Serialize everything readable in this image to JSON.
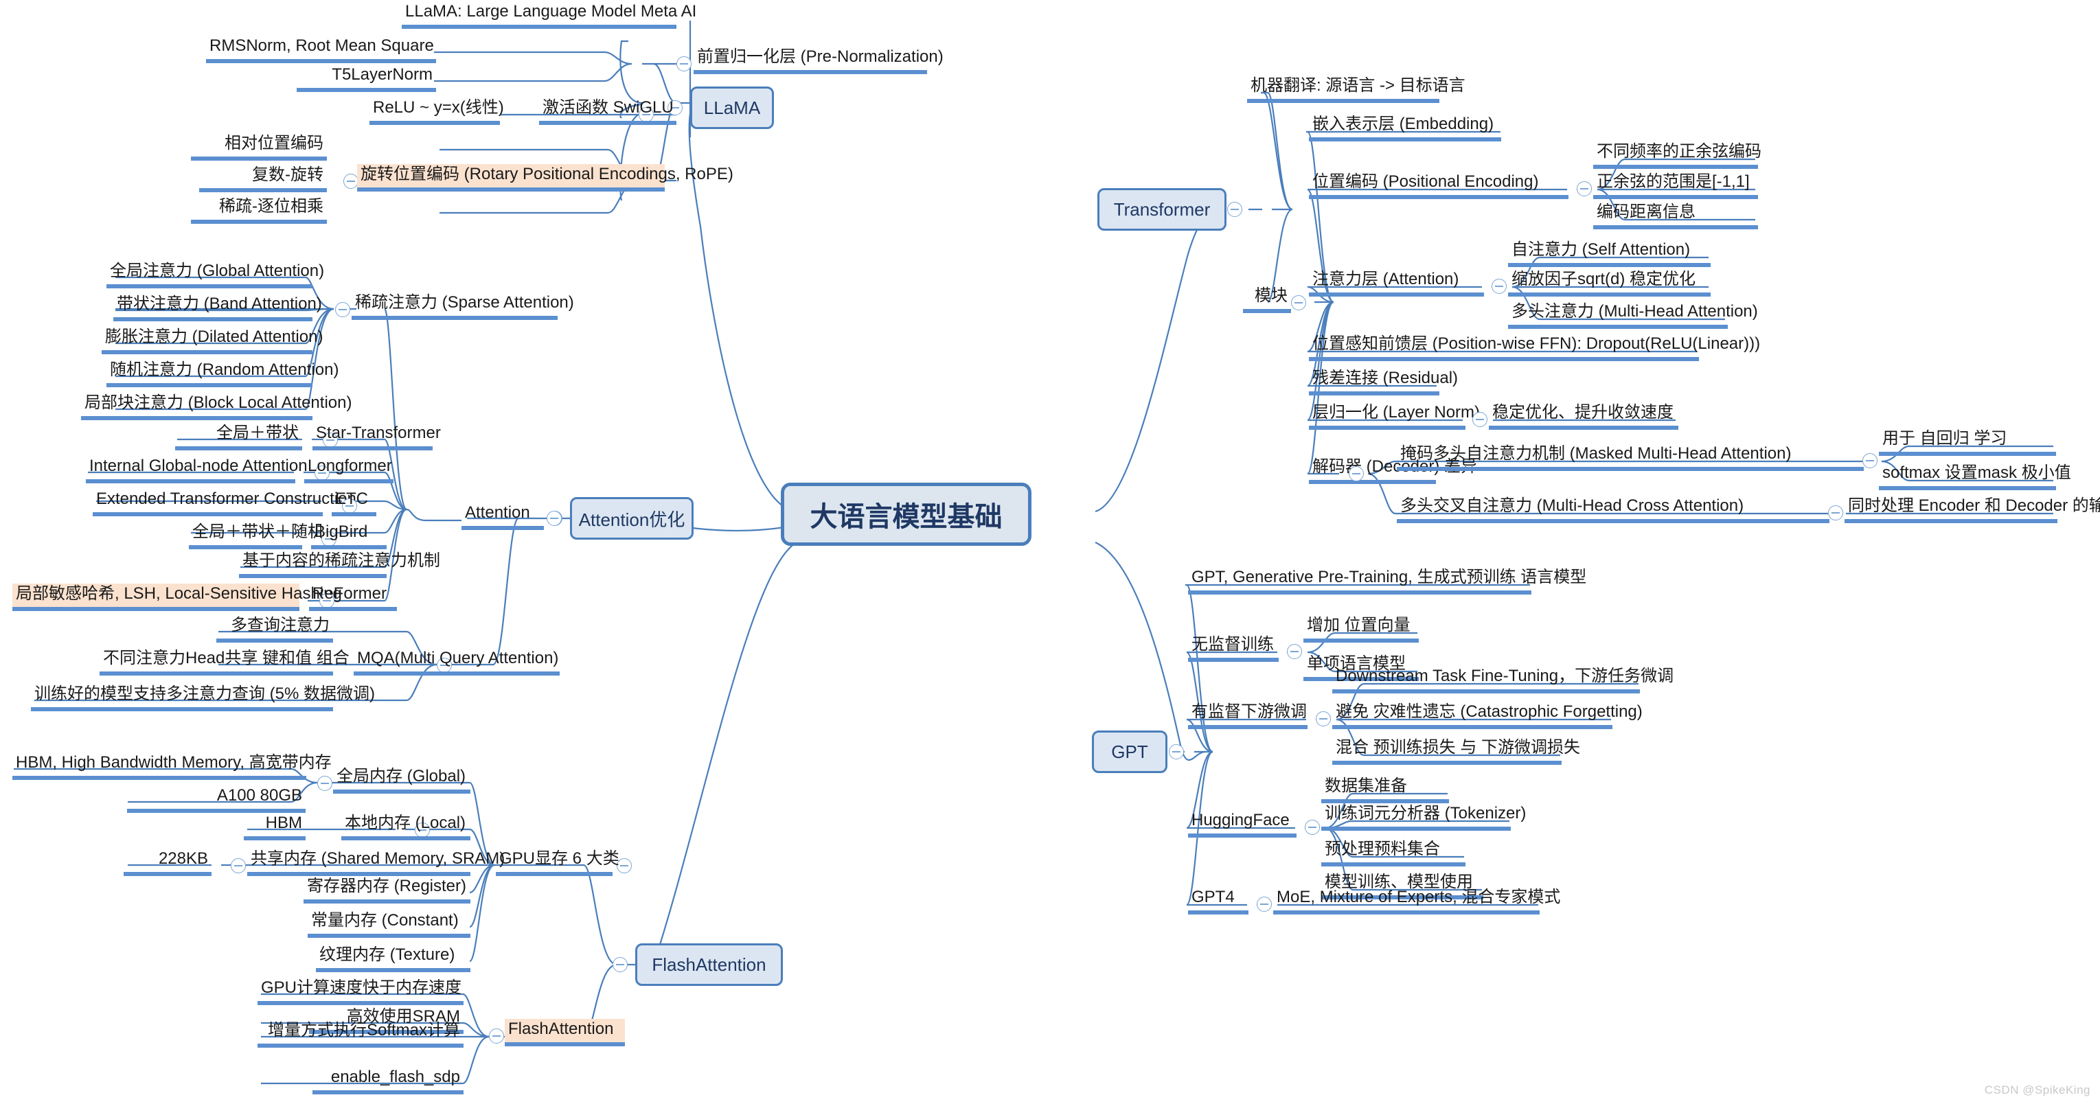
{
  "meta": {
    "watermark": "CSDN @SpikeKing",
    "colors": {
      "branch_line": "#4a7ebb",
      "leaf_bar": "#5b8fd0",
      "node_fill": "#dce6f2",
      "node_border": "#4a7ebb",
      "node_text": "#1f3864",
      "highlight_fill": "#fbe2cf",
      "background": "#ffffff"
    }
  },
  "root": {
    "label": "大语言模型基础"
  },
  "branches": {
    "llama": {
      "label": "LLaMA",
      "children": {
        "title": "LLaMA: Large Language Model Meta AI",
        "prenorm": {
          "label": "前置归一化层 (Pre-Normalization)",
          "items": [
            "RMSNorm, Root Mean Square",
            "T5LayerNorm"
          ]
        },
        "activation": {
          "label": "激活函数 SwiGLU",
          "items": [
            "ReLU ~ y=x(线性)"
          ]
        },
        "rope": {
          "label": "旋转位置编码 (Rotary Positional Encodings, RoPE)",
          "items": [
            "相对位置编码",
            "复数-旋转",
            "稀疏-逐位相乘"
          ]
        }
      }
    },
    "attention_opt": {
      "label": "Attention优化",
      "sub": {
        "label": "Attention",
        "sparse": {
          "label": "稀疏注意力 (Sparse Attention)",
          "items": [
            "全局注意力 (Global Attention)",
            "带状注意力 (Band Attention)",
            "膨胀注意力 (Dilated Attention)",
            "随机注意力 (Random Attention)",
            "局部块注意力 (Block Local Attention)"
          ]
        },
        "models": [
          {
            "name": "Star-Transformer",
            "desc": "全局＋带状"
          },
          {
            "name": "Longformer",
            "desc": "Internal Global-node Attention"
          },
          {
            "name": "ETC",
            "desc": "Extended Transformer Construction"
          },
          {
            "name": "BigBird",
            "desc": "全局＋带状＋随机"
          },
          {
            "name": "ReFormer",
            "desc": "局部敏感哈希, LSH, Local-Sensitive Hashing",
            "highlight": true
          }
        ],
        "content_sparse": "基于内容的稀疏注意力机制"
      },
      "mqa": {
        "label": "MQA(Multi Query Attention)",
        "items": [
          "多查询注意力",
          "不同注意力Head共享 键和值 组合",
          "训练好的模型支持多注意力查询 (5% 数据微调)"
        ]
      }
    },
    "flashattention": {
      "label": "FlashAttention",
      "gpu_memory": {
        "label": "GPU显存 6 大类",
        "items": [
          {
            "name": "全局内存 (Global)",
            "notes": [
              "HBM, High Bandwidth Memory, 高宽带内存",
              "A100 80GB"
            ]
          },
          {
            "name": "本地内存 (Local)",
            "notes": [
              "HBM"
            ]
          },
          {
            "name": "共享内存 (Shared Memory, SRAM)",
            "notes": [
              "228KB"
            ]
          },
          {
            "name": "寄存器内存 (Register)",
            "notes": []
          },
          {
            "name": "常量内存 (Constant)",
            "notes": []
          },
          {
            "name": "纹理内存 (Texture)",
            "notes": []
          }
        ]
      },
      "flash": {
        "label": "FlashAttention",
        "highlight": true,
        "items": [
          "GPU计算速度快于内存速度",
          "高效使用SRAM",
          "增量方式执行Softmax计算",
          "enable_flash_sdp"
        ]
      }
    },
    "transformer": {
      "label": "Transformer",
      "task": "机器翻译: 源语言 -> 目标语言",
      "modules": {
        "label": "模块",
        "embedding": "嵌入表示层 (Embedding)",
        "positional": {
          "label": "位置编码 (Positional Encoding)",
          "items": [
            "不同频率的正余弦编码",
            "正余弦的范围是[-1,1]",
            "编码距离信息"
          ]
        },
        "attention": {
          "label": "注意力层 (Attention)",
          "items": [
            "自注意力 (Self Attention)",
            "缩放因子sqrt(d) 稳定优化",
            "多头注意力 (Multi-Head Attention)"
          ]
        },
        "ffn": "位置感知前馈层 (Position-wise FFN): Dropout(ReLU(Linear)))",
        "residual": "残差连接 (Residual)",
        "layernorm": {
          "label": "层归一化 (Layer Norm)",
          "note": "稳定优化、提升收敛速度"
        },
        "decoder": {
          "label": "解码器 (Decoder) 差异",
          "masked": {
            "label": "掩码多头自注意力机制 (Masked Multi-Head Attention)",
            "notes": [
              "用于 自回归 学习",
              "softmax 设置mask 极小值"
            ]
          },
          "cross": {
            "label": "多头交叉自注意力 (Multi-Head Cross Attention)",
            "note": "同时处理 Encoder 和 Decoder 的输入"
          }
        }
      }
    },
    "gpt": {
      "label": "GPT",
      "title": "GPT, Generative Pre-Training, 生成式预训练 语言模型",
      "unsupervised": {
        "label": "无监督训练",
        "items": [
          "增加 位置向量",
          "单项语言模型"
        ]
      },
      "finetune": {
        "label": "有监督下游微调",
        "items": [
          "Downstream Task Fine-Tuning，下游任务微调",
          "避免 灾难性遗忘 (Catastrophic Forgetting)",
          "混合 预训练损失 与 下游微调损失"
        ]
      },
      "huggingface": {
        "label": "HuggingFace",
        "items": [
          "数据集准备",
          "训练词元分析器 (Tokenizer)",
          "预处理预料集合",
          "模型训练、模型使用"
        ]
      },
      "gpt4": {
        "label": "GPT4",
        "note": "MoE, Mixture of Experts, 混合专家模式"
      }
    }
  }
}
